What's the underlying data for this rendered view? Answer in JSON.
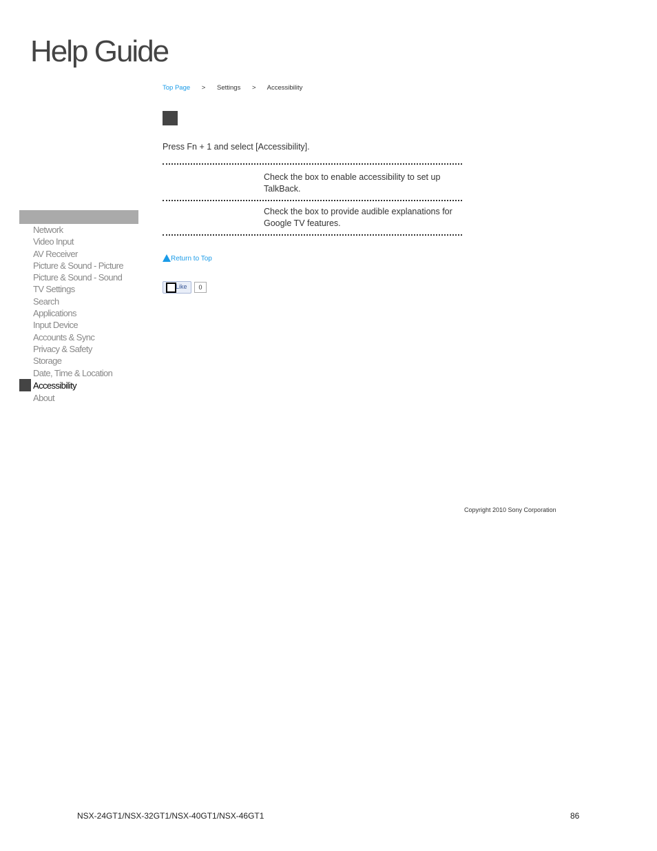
{
  "header": {
    "title": "Help Guide"
  },
  "breadcrumb": [
    {
      "label": "Top Page",
      "link": true
    },
    {
      "label": ">"
    },
    {
      "label": "Settings"
    },
    {
      "label": ">"
    },
    {
      "label": "Accessibility"
    }
  ],
  "main": {
    "intro": "Press Fn + 1 and select [Accessibility].",
    "rows": [
      {
        "description": "Check the box to enable accessibility to set up TalkBack."
      },
      {
        "description": "Check the box to provide audible explanations for Google TV features."
      }
    ],
    "return_to_top": "Return to Top",
    "like_label": "Like",
    "like_count": "0"
  },
  "sidebar": {
    "items": [
      {
        "label": "Network"
      },
      {
        "label": "Video Input"
      },
      {
        "label": "AV Receiver"
      },
      {
        "label": "Picture & Sound - Picture"
      },
      {
        "label": "Picture & Sound - Sound"
      },
      {
        "label": "TV Settings"
      },
      {
        "label": "Search"
      },
      {
        "label": "Applications"
      },
      {
        "label": "Input Device"
      },
      {
        "label": "Accounts & Sync"
      },
      {
        "label": "Privacy & Safety"
      },
      {
        "label": "Storage"
      },
      {
        "label": "Date, Time & Location"
      },
      {
        "label": "Accessibility",
        "active": true
      },
      {
        "label": "About"
      }
    ]
  },
  "footer": {
    "copyright": "Copyright 2010 Sony Corporation",
    "models": "NSX-24GT1/NSX-32GT1/NSX-40GT1/NSX-46GT1",
    "page_number": "86"
  },
  "colors": {
    "link": "#1a9be8",
    "active_marker": "#444444",
    "nav_header": "#aaaaaa"
  }
}
